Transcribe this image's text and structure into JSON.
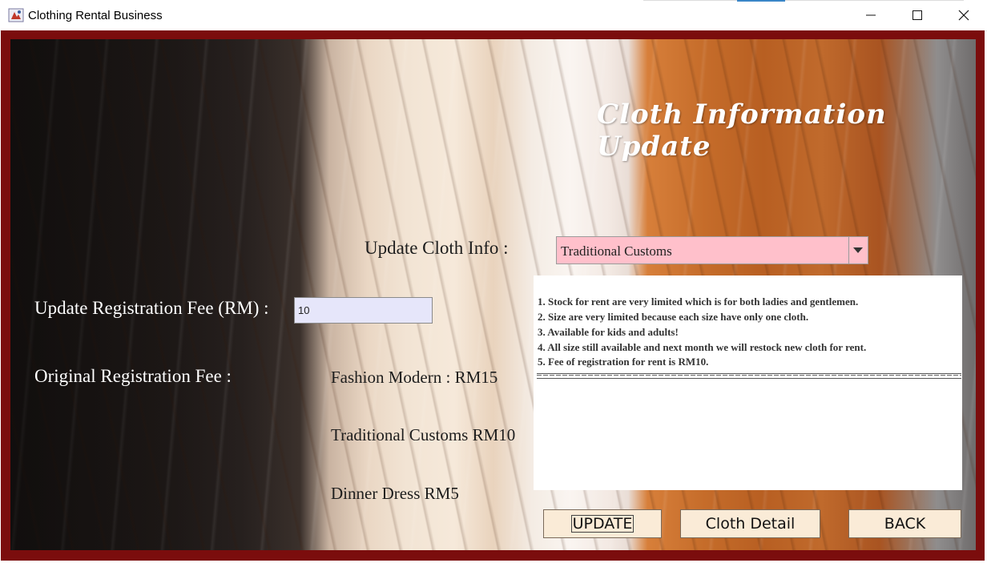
{
  "window": {
    "title": "Clothing Rental Business",
    "controls": [
      "minimize",
      "maximize",
      "close"
    ]
  },
  "form": {
    "heading": "Cloth Information Update",
    "update_cloth_label": "Update Cloth Info :",
    "cloth_type": {
      "selected": "Traditional Customs"
    },
    "update_fee_label": "Update Registration Fee (RM) :",
    "fee_value": "10",
    "original_fee_label": "Original Registration Fee :",
    "original_fees": [
      "Fashion Modern : RM15",
      "Traditional Customs RM10",
      "Dinner Dress RM5"
    ]
  },
  "notes": {
    "lines": [
      "1. Stock for rent are very limited which is for both ladies and gentlemen.",
      "2. Size are very limited because each size have only one cloth.",
      "3. Available for kids and adults!",
      "4. All size still available and next month we will restock new cloth for rent.",
      "5. Fee of registration for rent is RM10."
    ]
  },
  "buttons": {
    "update": "UPDATE",
    "cloth_detail": "Cloth Detail",
    "back": "BACK"
  },
  "colors": {
    "frame": "#7b0d0d",
    "combo_bg": "#ffc0cb",
    "input_bg": "#e6e6fa",
    "button_bg": "#faebd7"
  }
}
